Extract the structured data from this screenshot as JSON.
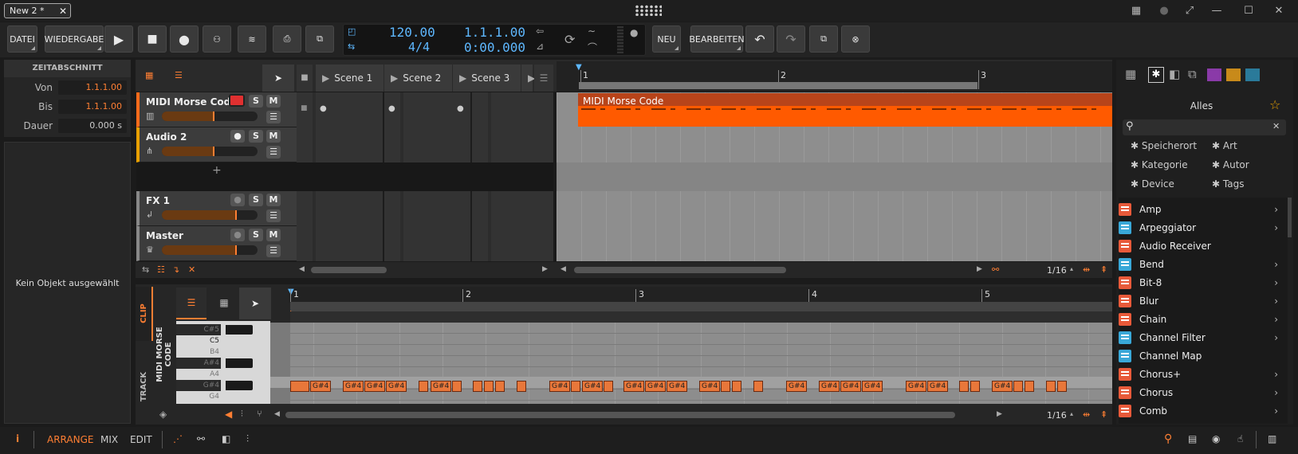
{
  "titlebar": {
    "tab_title": "New 2 *"
  },
  "toolbar": {
    "file": "DATEI",
    "playback": "WIEDERGABE",
    "tempo": "120.00",
    "signature": "4/4",
    "position_bars": "1.1.1.00",
    "position_time": "0:00.000",
    "new": "NEU",
    "edit": "BEARBEITEN"
  },
  "inspector": {
    "header": "ZEITABSCHNITT",
    "from_label": "Von",
    "from_value": "1.1.1.00",
    "to_label": "Bis",
    "to_value": "1.1.1.00",
    "duration_label": "Dauer",
    "duration_value": "0.000 s",
    "empty_text": "Kein Objekt ausgewählt"
  },
  "tracks": [
    {
      "name": "MIDI Morse Code",
      "color": "#ff6b1a"
    },
    {
      "name": "Audio 2",
      "color": "#e8a000"
    },
    {
      "name": "FX 1",
      "color": "#888888"
    },
    {
      "name": "Master",
      "color": "#888888"
    }
  ],
  "scenes": [
    "Scene 1",
    "Scene 2",
    "Scene 3"
  ],
  "arrange": {
    "ruler": [
      "1",
      "2",
      "3"
    ],
    "clip_name": "MIDI Morse Code",
    "grid": "1/16"
  },
  "editor": {
    "side_clip": "CLIP",
    "side_track": "TRACK",
    "clip_title": "MIDI MORSE CODE",
    "ruler": [
      "1",
      "2",
      "3",
      "4",
      "5"
    ],
    "keys": [
      "C#5",
      "C5",
      "B4",
      "A#4",
      "A4",
      "G#4",
      "G4"
    ],
    "note_label": "G#4",
    "grid": "1/16"
  },
  "browser": {
    "title": "Alles",
    "filters": [
      "Speicherort",
      "Art",
      "Kategorie",
      "Autor",
      "Device",
      "Tags"
    ],
    "items": [
      {
        "label": "Amp",
        "kind": "r",
        "sub": true
      },
      {
        "label": "Arpeggiator",
        "kind": "b",
        "sub": true
      },
      {
        "label": "Audio Receiver",
        "kind": "r",
        "sub": false
      },
      {
        "label": "Bend",
        "kind": "b",
        "sub": true
      },
      {
        "label": "Bit-8",
        "kind": "r",
        "sub": true
      },
      {
        "label": "Blur",
        "kind": "r",
        "sub": true
      },
      {
        "label": "Chain",
        "kind": "r",
        "sub": true
      },
      {
        "label": "Channel Filter",
        "kind": "b",
        "sub": true
      },
      {
        "label": "Channel Map",
        "kind": "b",
        "sub": false
      },
      {
        "label": "Chorus+",
        "kind": "r",
        "sub": true
      },
      {
        "label": "Chorus",
        "kind": "r",
        "sub": true
      },
      {
        "label": "Comb",
        "kind": "r",
        "sub": true
      }
    ]
  },
  "bottom": {
    "arrange": "ARRANGE",
    "mix": "MIX",
    "edit": "EDIT"
  },
  "colors": {
    "accent": "#ff7f33",
    "display_blue": "#5eb8ff"
  }
}
